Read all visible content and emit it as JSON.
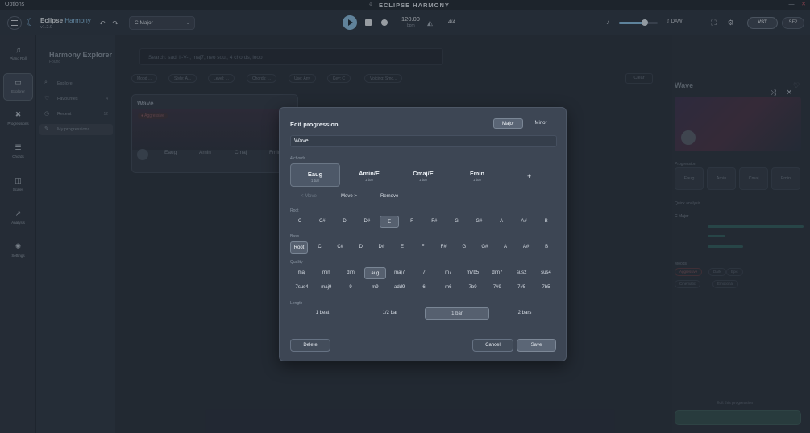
{
  "window": {
    "menu": "Options",
    "title": "ECLIPSE HARMONY",
    "min": "—",
    "close": "✕"
  },
  "toolbar": {
    "app_name": "Eclipse",
    "app_name_accent": "Harmony",
    "version": "v1.2.0",
    "key": "C Major",
    "bpm": "120.00",
    "bpm_unit": "bpm",
    "time_signature": "4/4",
    "volume": 0.66,
    "daw": "DAW",
    "vst": "VST",
    "sf2": "SF2"
  },
  "rail": [
    {
      "label": "Piano Roll",
      "icon": "♫"
    },
    {
      "label": "Explorer",
      "icon": "▭"
    },
    {
      "label": "Progressions",
      "icon": "✖"
    },
    {
      "label": "Chords",
      "icon": "☰"
    },
    {
      "label": "Scales",
      "icon": "◫"
    },
    {
      "label": "Analysis",
      "icon": "↗"
    },
    {
      "label": "Settings",
      "icon": "✺"
    }
  ],
  "sidepanel": {
    "title": "Harmony Explorer",
    "subtitle": "Found",
    "items": [
      {
        "label": "Explore",
        "icon": "⌕",
        "count": ""
      },
      {
        "label": "Favourites",
        "icon": "♡",
        "count": "4"
      },
      {
        "label": "Recent",
        "icon": "◷",
        "count": "12"
      },
      {
        "label": "My progressions",
        "icon": "✎",
        "count": ""
      }
    ]
  },
  "main": {
    "search_placeholder": "Search: sad, ii-V-I, maj7, neo soul, 4 chords, loop",
    "filters": [
      "Mood ...",
      "Style: A...",
      "Level: ...",
      "Chords: ...",
      "Use: Any",
      "Key: C",
      "Voicing: Smo..."
    ],
    "clear": "Clear",
    "card": {
      "title": "Wave",
      "tag": "● Aggressive",
      "chords": [
        "Eaug",
        "Amin",
        "Cmaj",
        "Fmin"
      ]
    }
  },
  "rightpanel": {
    "title": "Wave",
    "progression_label": "Progression",
    "chords": [
      "Eaug",
      "Amin",
      "Cmaj",
      "Fmin"
    ],
    "quick_analysis": "Quick analysis",
    "key_value": "C Major",
    "moods_label": "Moods",
    "moods": [
      "Aggressive",
      "Dark",
      "Epic",
      "Cinematic",
      "Emotional"
    ],
    "edit_link": "Edit this progression"
  },
  "modal": {
    "title": "Edit progression",
    "modes": [
      "Major",
      "Minor"
    ],
    "name": "Wave",
    "count_label": "4 chords",
    "slots": [
      {
        "name": "Eaug",
        "dur": "1 bar"
      },
      {
        "name": "Amin/E",
        "dur": "1 bar"
      },
      {
        "name": "Cmaj/E",
        "dur": "1 bar"
      },
      {
        "name": "Fmin",
        "dur": "1 bar"
      }
    ],
    "add": "+",
    "move_left": "< Move",
    "move_right": "Move >",
    "remove": "Remove",
    "root_label": "Root",
    "roots": [
      "C",
      "C#",
      "D",
      "D#",
      "E",
      "F",
      "F#",
      "G",
      "G#",
      "A",
      "A#",
      "B"
    ],
    "root_selected": "E",
    "bass_label": "Bass",
    "basses": [
      "Root",
      "C",
      "C#",
      "D",
      "D#",
      "E",
      "F",
      "F#",
      "G",
      "G#",
      "A",
      "A#",
      "B"
    ],
    "bass_selected": "Root",
    "quality_label": "Quality",
    "qualities_row1": [
      "maj",
      "min",
      "dim",
      "aug",
      "maj7",
      "7",
      "m7",
      "m7b5",
      "dim7",
      "sus2",
      "sus4"
    ],
    "qualities_row2": [
      "7sus4",
      "maj9",
      "9",
      "m9",
      "add9",
      "6",
      "m6",
      "7b9",
      "7#9",
      "7#5",
      "7b5"
    ],
    "quality_selected": "aug",
    "length_label": "Length",
    "lengths": [
      "1 beat",
      "1/2 bar",
      "1 bar",
      "2 bars"
    ],
    "length_selected": "1 bar",
    "delete": "Delete",
    "cancel": "Cancel",
    "save": "Save"
  }
}
